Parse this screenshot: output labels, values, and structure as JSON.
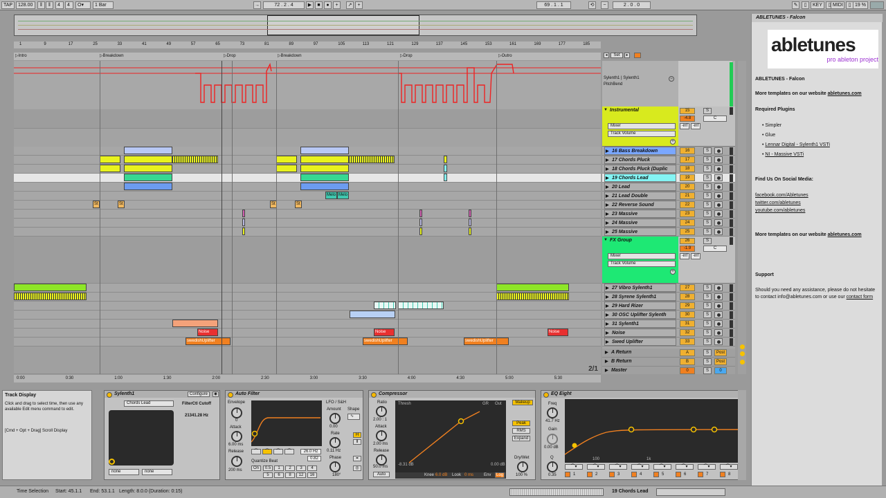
{
  "transport": {
    "tap": "TAP",
    "tempo": "128.00",
    "time_sig_num": "4",
    "time_sig_den": "4",
    "metro_symbol": "1 Bar",
    "loop_pos": "72 . 2 . 4",
    "loop_start": "69 . 1 . 1",
    "loop_len": "2 . 0 . 0",
    "key": "KEY",
    "midi": "MIDI",
    "cpu": "19 %",
    "circle_glyph": "O"
  },
  "locators": [
    {
      "label": "Intro"
    },
    {
      "label": "Breakdown"
    },
    {
      "label": "Drop"
    },
    {
      "label": "Breakdown"
    },
    {
      "label": "Drop"
    },
    {
      "label": "Outro"
    }
  ],
  "bar_numbers": [
    "1",
    "9",
    "17",
    "25",
    "33",
    "41",
    "49",
    "57",
    "65",
    "73",
    "81",
    "89",
    "97",
    "105",
    "113",
    "121",
    "129",
    "137",
    "145",
    "153",
    "161",
    "169",
    "177",
    "185"
  ],
  "time_ticks": [
    "0:00",
    "0:30",
    "1:00",
    "1:30",
    "2:00",
    "2:30",
    "3:00",
    "3:30",
    "4:00",
    "4:30",
    "5:00",
    "5:30"
  ],
  "page_indicator": "2/1",
  "header_top": {
    "set_label": "Set",
    "auto_device": "Sylenth1 | Sylenth1",
    "auto_param": "PitchBend"
  },
  "groups": [
    {
      "name": "Instrumental",
      "num": "15",
      "vol": "-4.8",
      "pan": "C",
      "inf1": "-inf",
      "inf2": "-inf",
      "mixer": "Mixer",
      "chooser": "Track Volume",
      "color": "#d8ea1e"
    },
    {
      "name": "FX Group",
      "num": "26",
      "vol": "-1.9",
      "pan": "C",
      "inf1": "-inf",
      "inf2": "-inf",
      "mixer": "Mixer",
      "chooser": "Track Volume",
      "color": "#1ee874"
    }
  ],
  "tracks_a": [
    {
      "name": "16 Bass Breakdown",
      "num": "16",
      "color": "#7aa7ff"
    },
    {
      "name": "17 Chords Pluck",
      "num": "17",
      "color": "#b0b0b0"
    },
    {
      "name": "18 Chords Pluck (Duplic",
      "num": "18",
      "color": "#b0b0b0"
    },
    {
      "name": "19 Chords Lead",
      "num": "19",
      "color": "#84f4f4"
    },
    {
      "name": "20 Lead",
      "num": "20",
      "color": "#b0b0b0"
    },
    {
      "name": "21 Lead Double",
      "num": "21",
      "color": "#b0b0b0"
    },
    {
      "name": "22 Reverse Sound",
      "num": "22",
      "color": "#b0b0b0"
    },
    {
      "name": "23 Massive",
      "num": "23",
      "color": "#b0b0b0"
    },
    {
      "name": "24 Massive",
      "num": "24",
      "color": "#b0b0b0"
    },
    {
      "name": "25 Massive",
      "num": "25",
      "color": "#b0b0b0"
    }
  ],
  "tracks_b": [
    {
      "name": "27 Vibro Sylenth1",
      "num": "27",
      "color": "#b0b0b0"
    },
    {
      "name": "28 Syrene Sylenth1",
      "num": "28",
      "color": "#b0b0b0"
    },
    {
      "name": "29 Hard Rizer",
      "num": "29",
      "color": "#b0b0b0"
    },
    {
      "name": "30 OSC Uplifter Sylenth",
      "num": "30",
      "color": "#b0b0b0"
    },
    {
      "name": "31 Sylenth1",
      "num": "31",
      "color": "#b0b0b0"
    },
    {
      "name": "Noise",
      "num": "32",
      "color": "#b0b0b0"
    },
    {
      "name": "Swed Uplifter",
      "num": "33",
      "color": "#b0b0b0"
    }
  ],
  "returns": [
    {
      "name": "A Return",
      "num": "A",
      "post": "Post"
    },
    {
      "name": "B Return",
      "num": "B",
      "post": "Post"
    },
    {
      "name": "Master",
      "num": "0",
      "post": "0"
    }
  ],
  "clips": {
    "melo1": "Melo",
    "melo2": "Melo",
    "st": "St",
    "swed": "swedishUplifter",
    "noise": "Noise"
  },
  "info": {
    "title": "ABLETUNES - Falcon",
    "logo_main": "abletunes",
    "logo_sub": "pro ableton project",
    "heading": "ABLETUNES - Falcon",
    "more1_prefix": "More templates on our website ",
    "more1_link": "abletunes.com",
    "required": "Required Plugins",
    "plugins": [
      "Simpler",
      "Glue",
      "Lennar Digital - Sylenth1 VSTi",
      "NI - Massive VSTi"
    ],
    "social_heading": "Find Us On Social Media:",
    "social": [
      "facebook.com/Abletunes",
      "twitter.com/abletunes",
      "youtube.com/abletunes"
    ],
    "more2_prefix": "More templates on our website ",
    "more2_link": "abletunes.com",
    "support": "Support",
    "support_text": "Should you need any assistance, please do not hesitate to contact info@abletunes.com or use our ",
    "support_link": "contact form"
  },
  "help": {
    "title": "Track Display",
    "text1": "Click and drag to select time, then use any available Edit menu command to edit.",
    "text2": "[Cmd + Opt + Drag] Scroll Display"
  },
  "sylenth": {
    "title": "Sylenth1",
    "configure": "Configure",
    "preset": "Chords Lead",
    "param_name": "FilterCtl Cutoff",
    "param_value": "21341.28 Hz",
    "none1": "none",
    "none2": "none"
  },
  "autofilter": {
    "title": "Auto Filter",
    "envelope": "Envelope",
    "env_val": "0",
    "attack": "Attack",
    "attack_val": "6.00 ms",
    "release": "Release",
    "release_val": "200 ms",
    "freq": "26.0 Hz",
    "q": "0.82",
    "quantize": "Quantize Beat",
    "q_on": "On",
    "q_vals": [
      "0.5",
      "1",
      "2",
      "3",
      "4",
      "5",
      "6",
      "8",
      "12",
      "16"
    ],
    "lfo": "LFO / S&H",
    "amount": "Amount",
    "amount_val": "0.00",
    "shape": "Shape",
    "rate": "Rate",
    "rate_val": "0.11 Hz",
    "phase": "Phase",
    "phase_val": "180°"
  },
  "compressor": {
    "title": "Compressor",
    "ratio": "Ratio",
    "ratio_val": "2.00 : 1",
    "attack": "Attack",
    "attack_val": "2.00 ms",
    "release": "Release",
    "release_val": "50.0 ms",
    "auto": "Auto",
    "thresh": "Thresh",
    "gr": "GR",
    "out": "Out",
    "thresh_val": "-8.31 dB",
    "out_val": "0.00 dB",
    "knee": "Knee",
    "knee_val": "6.0 dB",
    "look": "Look",
    "look_val": "0 ms",
    "env": "Env",
    "env_val": "Log",
    "makeup": "Makeup",
    "peak": "Peak",
    "rms": "RMS",
    "expand": "Expand",
    "drywet": "Dry/Wet",
    "drywet_val": "100 %"
  },
  "eq": {
    "title": "EQ Eight",
    "freq": "Freq",
    "freq_val": "41.7 Hz",
    "gain": "Gain",
    "gain_val": "0.00 dB",
    "q": "Q",
    "q_val": "0.35",
    "tick_100": "100",
    "tick_1k": "1k",
    "bands": [
      "1",
      "2",
      "3",
      "4",
      "5",
      "6",
      "7",
      "8"
    ]
  },
  "status": {
    "time_sel": "Time Selection",
    "start": "Start: 45.1.1",
    "end": "End: 53.1.1",
    "length": "Length: 8.0.0 (Duration: 0:15)",
    "track": "19 Chords Lead"
  }
}
